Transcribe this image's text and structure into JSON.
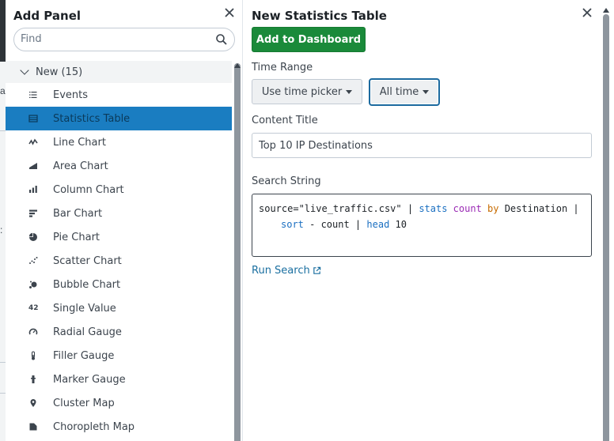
{
  "left_panel": {
    "title": "Add Panel",
    "search_placeholder": "Find",
    "group_label": "New (15)",
    "items": [
      {
        "label": "Events",
        "icon": "events-icon"
      },
      {
        "label": "Statistics Table",
        "icon": "table-icon",
        "selected": true
      },
      {
        "label": "Line Chart",
        "icon": "line-chart-icon"
      },
      {
        "label": "Area Chart",
        "icon": "area-chart-icon"
      },
      {
        "label": "Column Chart",
        "icon": "column-chart-icon"
      },
      {
        "label": "Bar Chart",
        "icon": "bar-chart-icon"
      },
      {
        "label": "Pie Chart",
        "icon": "pie-chart-icon"
      },
      {
        "label": "Scatter Chart",
        "icon": "scatter-chart-icon"
      },
      {
        "label": "Bubble Chart",
        "icon": "bubble-chart-icon"
      },
      {
        "label": "Single Value",
        "icon": "single-value-icon",
        "glyph": "42"
      },
      {
        "label": "Radial Gauge",
        "icon": "radial-gauge-icon"
      },
      {
        "label": "Filler Gauge",
        "icon": "filler-gauge-icon"
      },
      {
        "label": "Marker Gauge",
        "icon": "marker-gauge-icon"
      },
      {
        "label": "Cluster Map",
        "icon": "cluster-map-icon"
      },
      {
        "label": "Choropleth Map",
        "icon": "choropleth-map-icon"
      }
    ]
  },
  "right_panel": {
    "title": "New Statistics Table",
    "add_button": "Add to Dashboard",
    "time_range_label": "Time Range",
    "time_picker_button": "Use time picker",
    "all_time_button": "All time",
    "content_title_label": "Content Title",
    "content_title_value": "Top 10 IP Destinations",
    "search_string_label": "Search String",
    "search_string": {
      "line1": [
        {
          "t": "source=\"live_traffic.csv\"",
          "c": "str"
        },
        {
          "t": " | ",
          "c": "op"
        },
        {
          "t": "stats",
          "c": "cmd"
        },
        {
          "t": " ",
          "c": "op"
        },
        {
          "t": "count",
          "c": "fn"
        },
        {
          "t": " ",
          "c": "op"
        },
        {
          "t": "by",
          "c": "kw"
        },
        {
          "t": " Destination |",
          "c": "op"
        }
      ],
      "line2": [
        {
          "t": "sort",
          "c": "cmd"
        },
        {
          "t": " - count | ",
          "c": "op"
        },
        {
          "t": "head",
          "c": "cmd"
        },
        {
          "t": " 10",
          "c": "num"
        }
      ]
    },
    "run_search_link": "Run Search"
  },
  "colors": {
    "primary_green": "#1a8a3a",
    "selected_blue": "#1a7dc1",
    "link_blue": "#1a6fa0",
    "focus_border": "#1c6a9f"
  },
  "background": {
    "edge_glyphs": [
      "a",
      ":"
    ]
  }
}
